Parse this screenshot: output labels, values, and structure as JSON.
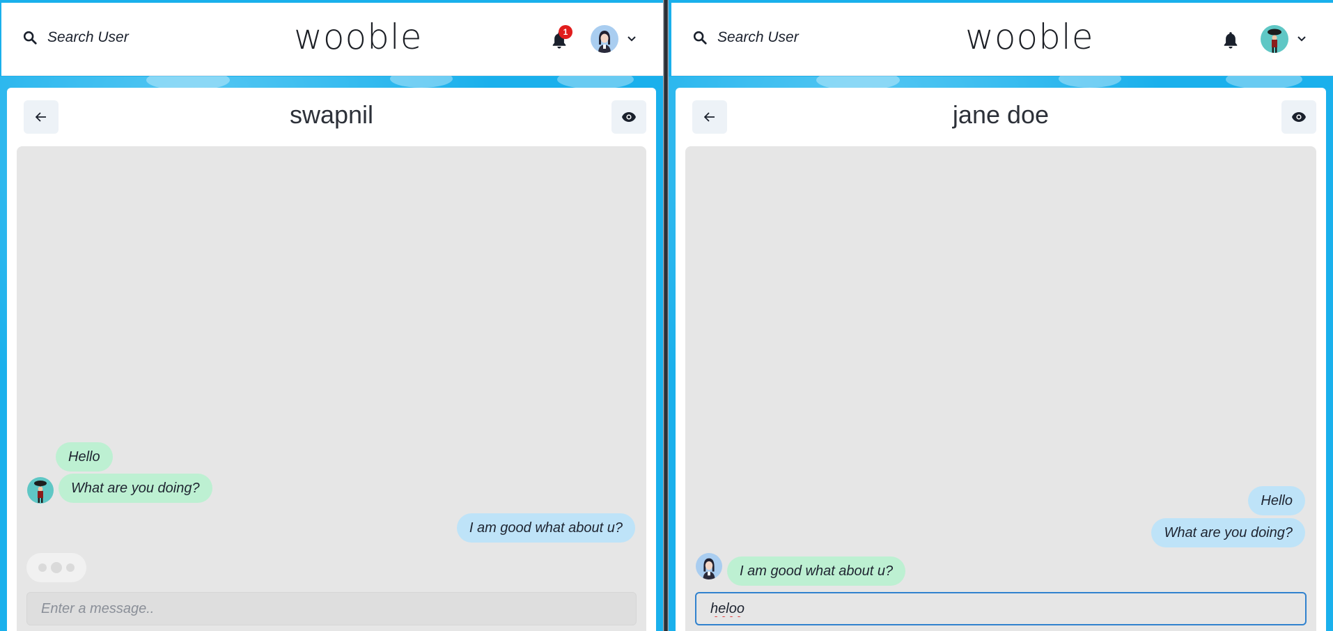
{
  "app": {
    "logo_text": "wooble"
  },
  "left_window": {
    "search_label": "Search User",
    "notification_count": "1",
    "chat_title": "swapnil",
    "messages": [
      {
        "text": "Hello",
        "side": "in"
      },
      {
        "text": "What are you doing?",
        "side": "in"
      },
      {
        "text": "I am good what about u?",
        "side": "out"
      }
    ],
    "typing_indicator": true,
    "input_placeholder": "Enter a message..",
    "input_value": ""
  },
  "right_window": {
    "search_label": "Search User",
    "chat_title": "jane doe",
    "messages": [
      {
        "text": "Hello",
        "side": "out"
      },
      {
        "text": "What are you doing?",
        "side": "out"
      },
      {
        "text": "I am good what about u?",
        "side": "in"
      }
    ],
    "input_value": "heloo"
  },
  "icons": {
    "search": "search-icon",
    "notifications": "bell-icon",
    "menu": "chevron-down-icon",
    "back": "arrow-left-icon",
    "view_profile": "eye-icon"
  },
  "colors": {
    "background": "#1ab0ec",
    "incoming_bubble": "#bdf0d2",
    "outgoing_bubble": "#bee3f8",
    "chat_area": "#e6e6e6",
    "badge": "#e11d1d",
    "input_focus": "#3182ce"
  }
}
